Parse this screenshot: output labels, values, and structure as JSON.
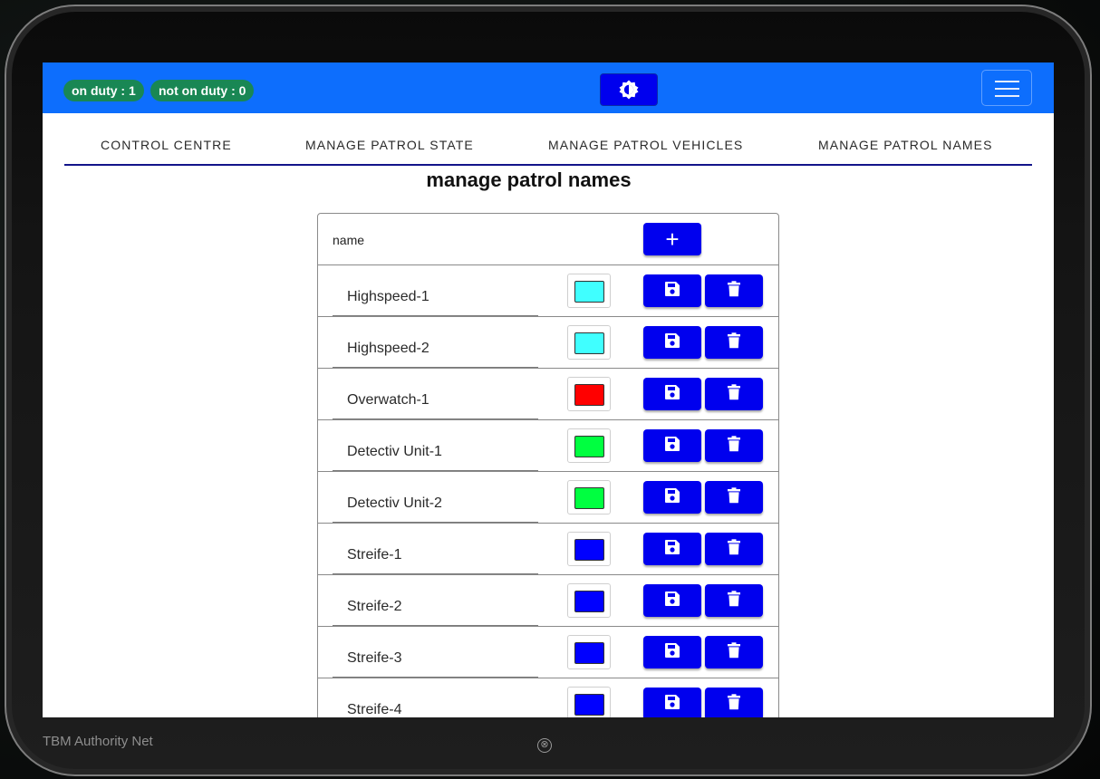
{
  "status": {
    "on_duty": "on duty : 1",
    "not_on_duty": "not on duty : 0"
  },
  "tabs": [
    {
      "label": "CONTROL CENTRE"
    },
    {
      "label": "MANAGE PATROL STATE"
    },
    {
      "label": "MANAGE PATROL VEHICLES"
    },
    {
      "label": "MANAGE PATROL NAMES"
    }
  ],
  "page_title": "manage patrol names",
  "table": {
    "header_name": "name",
    "add_label": "+",
    "rows": [
      {
        "name": "Highspeed-1",
        "color": "#40ffff"
      },
      {
        "name": "Highspeed-2",
        "color": "#40ffff"
      },
      {
        "name": "Overwatch-1",
        "color": "#ff0000"
      },
      {
        "name": "Detectiv Unit-1",
        "color": "#00ff40"
      },
      {
        "name": "Detectiv Unit-2",
        "color": "#00ff40"
      },
      {
        "name": "Streife-1",
        "color": "#0000ff"
      },
      {
        "name": "Streife-2",
        "color": "#0000ff"
      },
      {
        "name": "Streife-3",
        "color": "#0000ff"
      },
      {
        "name": "Streife-4",
        "color": "#0000ff"
      }
    ]
  },
  "footer": {
    "brand": "TBM Authority Net",
    "close_symbol": "⊗"
  },
  "colors": {
    "navbar": "#0d6efd",
    "button": "#0000ee",
    "badge": "#198754",
    "tab_underline": "#12148a"
  },
  "icons": {
    "theme": "brightness-icon",
    "menu": "hamburger-icon",
    "save": "floppy-disk-icon",
    "delete": "trash-icon",
    "close": "close-circle-icon"
  }
}
